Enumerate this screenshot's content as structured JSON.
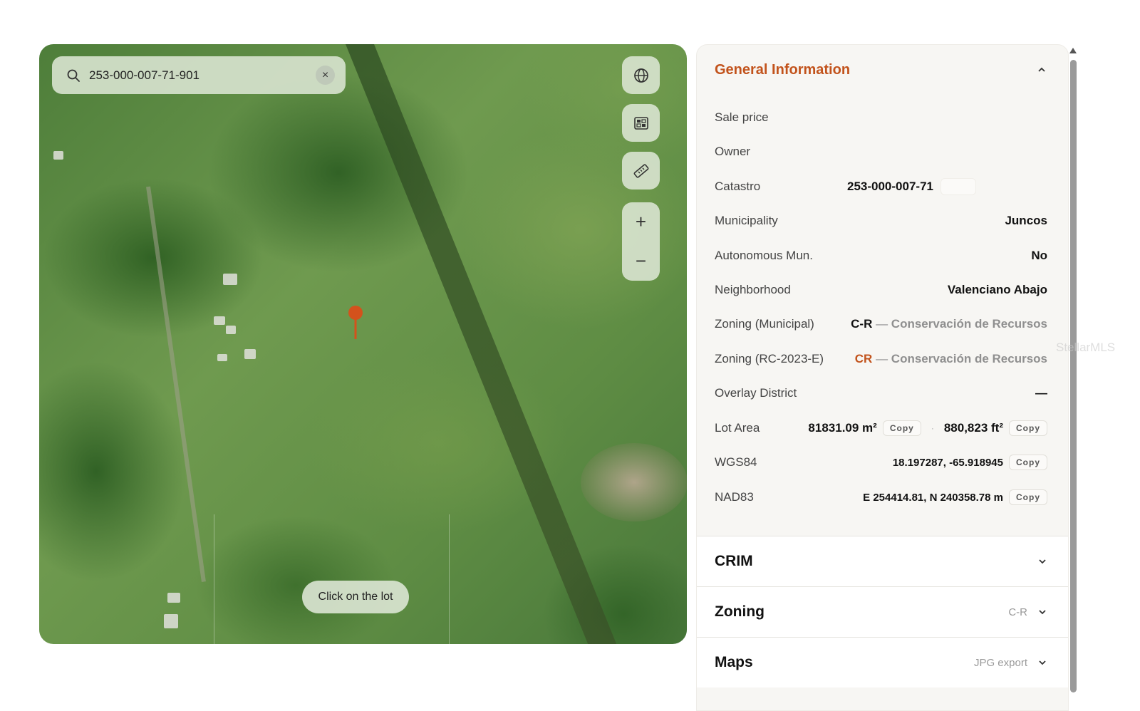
{
  "map": {
    "search_value": "253-000-007-71-901",
    "clear_label": "×",
    "zoom_in_label": "+",
    "zoom_out_label": "−",
    "hint_label": "Click on the lot",
    "controls": [
      "globe-icon",
      "qr-code-icon",
      "ruler-icon"
    ]
  },
  "general": {
    "title": "General Information",
    "rows": {
      "sale_price": {
        "label": "Sale price",
        "value": ""
      },
      "owner": {
        "label": "Owner",
        "value": ""
      },
      "catastro": {
        "label": "Catastro",
        "value": "253-000-007-71"
      },
      "municipality": {
        "label": "Municipality",
        "value": "Juncos"
      },
      "autonomous": {
        "label": "Autonomous Mun.",
        "value": "No"
      },
      "neighborhood": {
        "label": "Neighborhood",
        "value": "Valenciano Abajo"
      },
      "zoning_municipal": {
        "label": "Zoning (Municipal)",
        "code": "C-R",
        "sep": " — ",
        "desc": "Conservación de Recursos"
      },
      "zoning_rc": {
        "label": "Zoning (RC-2023-E)",
        "code": "CR",
        "sep": " — ",
        "desc": "Conservación de Recursos"
      },
      "overlay": {
        "label": "Overlay District",
        "value": "—"
      },
      "lot_area": {
        "label": "Lot Area",
        "m2": "81831.09 m²",
        "dot": "·",
        "ft2": "880,823 ft²"
      },
      "wgs84": {
        "label": "WGS84",
        "value": "18.197287, -65.918945"
      },
      "nad83": {
        "label": "NAD83",
        "value": "E 254414.81, N 240358.78 m"
      }
    },
    "copy_label": "Copy"
  },
  "sections": {
    "crim": {
      "title": "CRIM",
      "right": ""
    },
    "zoning": {
      "title": "Zoning",
      "right": "C-R"
    },
    "maps": {
      "title": "Maps",
      "right": "JPG export"
    }
  },
  "watermark": "StellarMLS",
  "colors": {
    "accent": "#c2531c",
    "panel_bg": "#f7f6f3"
  }
}
